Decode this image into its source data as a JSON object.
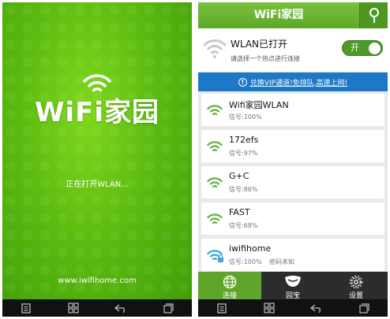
{
  "splash": {
    "logo_text": "WiFi家园",
    "status": "正在打开WLAN...",
    "url": "www.iwifihome.com"
  },
  "app": {
    "title": "WiFi家园",
    "wlan": {
      "title": "WLAN已打开",
      "subtitle": "请选择一个热点进行连接",
      "toggle_label": "开"
    },
    "vip_banner": "兑换VIP通道!免排队,高速上网!",
    "networks": [
      {
        "name": "Wifi家园WLAN",
        "signal": "信号:100%",
        "extra": "",
        "icon_color": "#6ab34a"
      },
      {
        "name": "172efs",
        "signal": "信号:97%",
        "extra": "",
        "icon_color": "#6ab34a"
      },
      {
        "name": "G+C",
        "signal": "信号:86%",
        "extra": "",
        "icon_color": "#6ab34a"
      },
      {
        "name": "FAST",
        "signal": "信号:68%",
        "extra": "",
        "icon_color": "#6ab34a"
      },
      {
        "name": "iwifihome",
        "signal": "信号:100%",
        "extra": "密码未知",
        "icon_color": "#3fa7d8"
      }
    ],
    "tabs": [
      {
        "label": "连接",
        "icon": "globe-icon"
      },
      {
        "label": "园宝",
        "icon": "smile-icon"
      },
      {
        "label": "设置",
        "icon": "gear-icon"
      }
    ]
  },
  "colors": {
    "brand_green": "#5ea82a",
    "banner_blue": "#1e78c8"
  }
}
